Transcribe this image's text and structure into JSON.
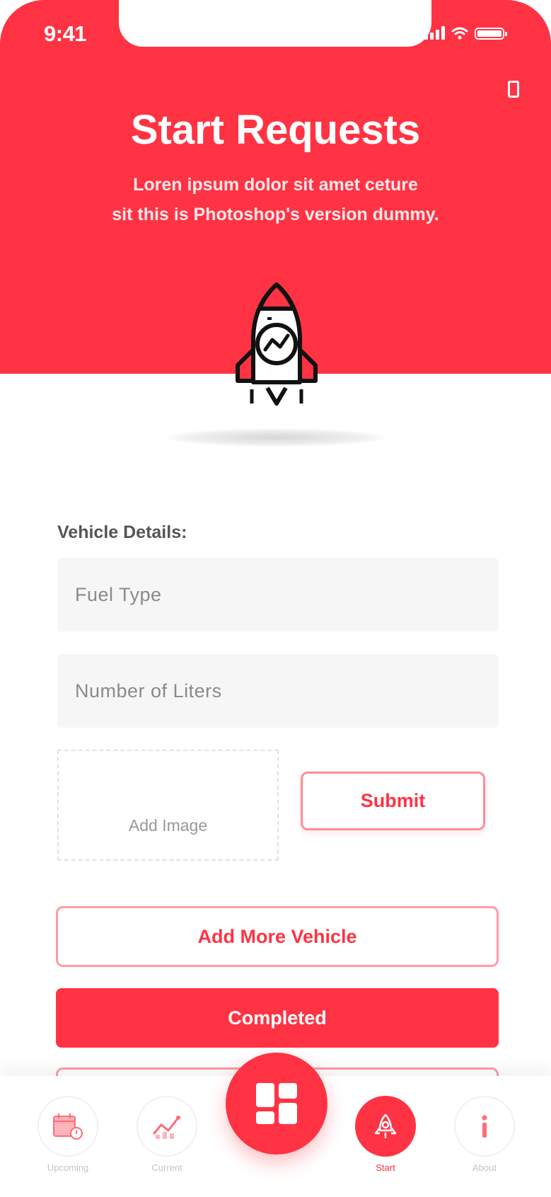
{
  "status_bar": {
    "time": "9:41"
  },
  "header": {
    "title": "Start Requests",
    "subtitle_line1": "Loren ipsum dolor sit amet ceture",
    "subtitle_line2": "sit  this is Photoshop's version dummy."
  },
  "form": {
    "section_label": "Vehicle Details:",
    "fuel_type": {
      "placeholder": "Fuel Type"
    },
    "liters": {
      "placeholder": "Number of Liters"
    },
    "add_image_label": "Add Image",
    "submit_label": "Submit",
    "add_more_label": "Add More Vehicle",
    "completed_label": "Completed"
  },
  "tabbar": {
    "items": [
      {
        "label": "Upcoming",
        "icon": "calendar-icon",
        "active": false
      },
      {
        "label": "Current",
        "icon": "chart-icon",
        "active": false
      },
      {
        "label": "Start",
        "icon": "rocket-icon",
        "active": true
      },
      {
        "label": "About",
        "icon": "info-icon",
        "active": false
      }
    ],
    "center_icon": "dashboard-grid-icon"
  },
  "colors": {
    "accent": "#ff3343",
    "field_bg": "#f6f6f6",
    "text_dark": "#555555"
  }
}
